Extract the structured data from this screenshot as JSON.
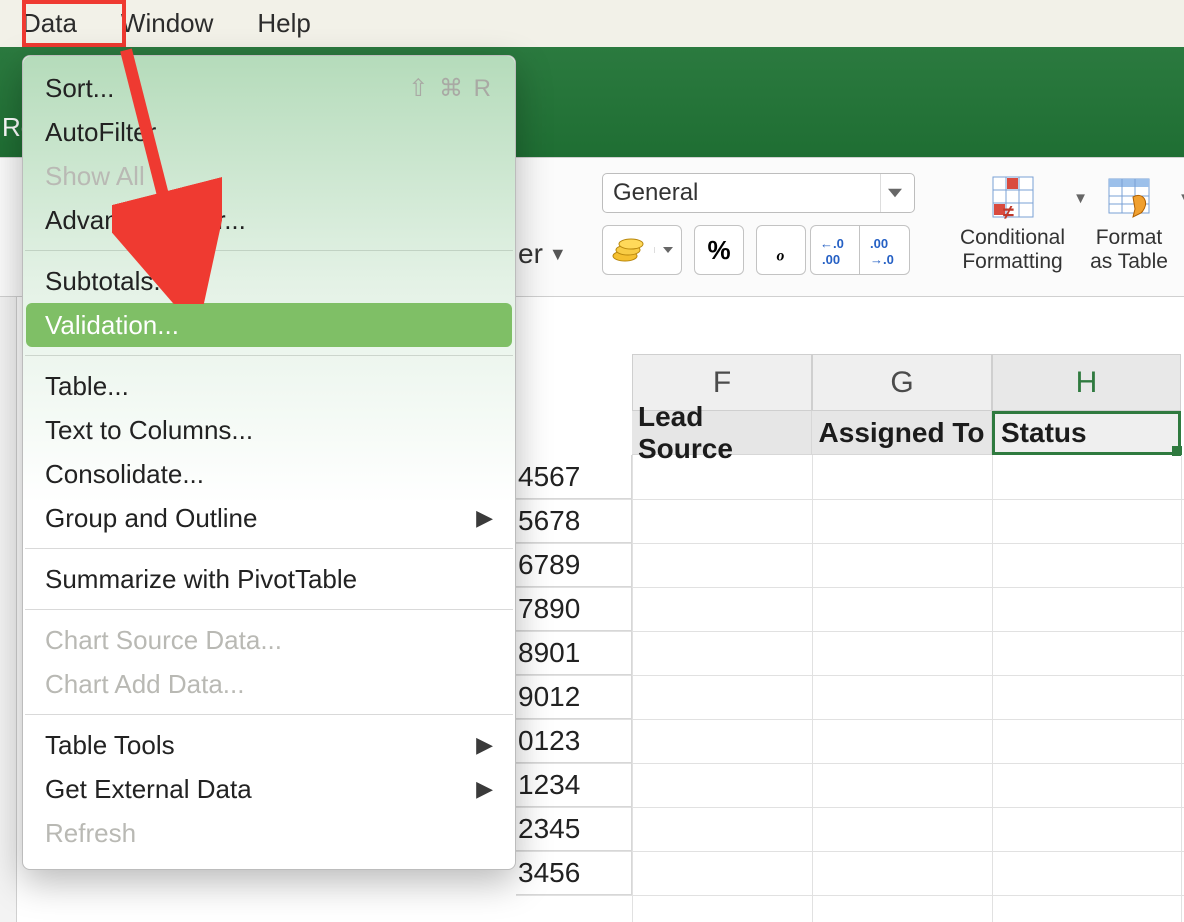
{
  "menubar": {
    "data": "Data",
    "window": "Window",
    "help": "Help"
  },
  "toolbar": {
    "partial_er": "er",
    "number_format": "General",
    "percent": "%",
    "comma": ",",
    "cond_fmt_l1": "Conditional",
    "cond_fmt_l2": "Formatting",
    "fmt_tbl_l1": "Format",
    "fmt_tbl_l2": "as Table"
  },
  "ribbon_partial": "Re",
  "dropdown": {
    "sort": "Sort...",
    "sort_shortcut": "⇧ ⌘ R",
    "autofilter": "AutoFilter",
    "show_all": "Show All",
    "adv_filter": "Advanced Filter...",
    "subtotals": "Subtotals...",
    "validation": "Validation...",
    "table": "Table...",
    "text_to_cols": "Text to Columns...",
    "consolidate": "Consolidate...",
    "group_outline": "Group and Outline",
    "pivot": "Summarize with PivotTable",
    "chart_src": "Chart Source Data...",
    "chart_add": "Chart Add Data...",
    "table_tools": "Table Tools",
    "ext_data": "Get External Data",
    "refresh": "Refresh"
  },
  "columns": {
    "f": "F",
    "g": "G",
    "h": "H"
  },
  "headers": {
    "f": "Lead Source",
    "g": "Assigned To",
    "h": "Status"
  },
  "partial_numbers": [
    "4567",
    "5678",
    "6789",
    "7890",
    "8901",
    "9012",
    "0123",
    "1234",
    "2345",
    "3456"
  ]
}
